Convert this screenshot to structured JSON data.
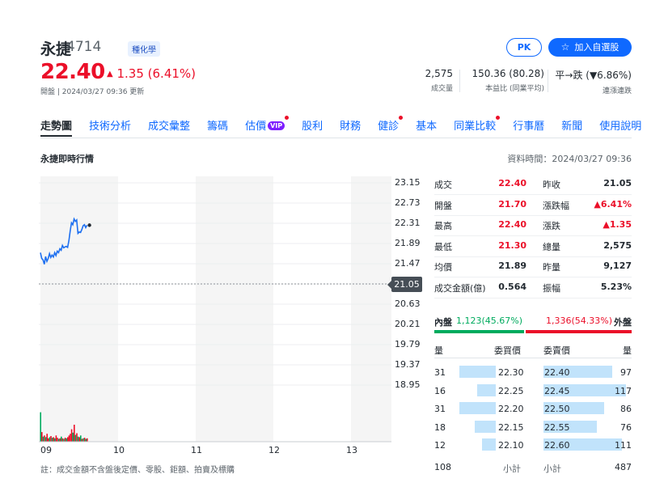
{
  "stock": {
    "name": "永捷",
    "code": "4714",
    "sector": "種化學",
    "price": "22.40",
    "change": "1.35 (6.41%)",
    "change_arrow": "▲",
    "status": "開盤 | 2024/03/27 09:36 更新"
  },
  "header_buttons": {
    "pk": "PK",
    "watchlist": "加入自選股",
    "watchlist_icon": "star-outline-icon"
  },
  "summary_stats": [
    {
      "value": "2,575",
      "label": "成交量"
    },
    {
      "value": "150.36 (80.28)",
      "label": "本益比 (同業平均)"
    },
    {
      "value": "平→跌 (▼6.86%)",
      "label": "連漲連跌"
    }
  ],
  "tabs": [
    {
      "label": "走勢圖",
      "active": true,
      "dot": false,
      "vip": false
    },
    {
      "label": "技術分析",
      "active": false,
      "dot": false,
      "vip": false
    },
    {
      "label": "成交彙整",
      "active": false,
      "dot": false,
      "vip": false
    },
    {
      "label": "籌碼",
      "active": false,
      "dot": false,
      "vip": false
    },
    {
      "label": "估價",
      "active": false,
      "dot": true,
      "vip": true
    },
    {
      "label": "股利",
      "active": false,
      "dot": false,
      "vip": false
    },
    {
      "label": "財務",
      "active": false,
      "dot": false,
      "vip": false
    },
    {
      "label": "健診",
      "active": false,
      "dot": true,
      "vip": false
    },
    {
      "label": "基本",
      "active": false,
      "dot": false,
      "vip": false
    },
    {
      "label": "同業比較",
      "active": false,
      "dot": true,
      "vip": false
    },
    {
      "label": "行事曆",
      "active": false,
      "dot": false,
      "vip": false
    },
    {
      "label": "新聞",
      "active": false,
      "dot": false,
      "vip": false
    },
    {
      "label": "使用說明",
      "active": false,
      "dot": false,
      "vip": false
    }
  ],
  "vip_label": "VIP",
  "section": {
    "title": "永捷即時行情",
    "data_time": "資料時間：2024/03/27 09:36"
  },
  "quote_rows": [
    {
      "l1": "成交",
      "v1": "22.40",
      "c1": "red",
      "l2": "昨收",
      "v2": "21.05",
      "c2": "black"
    },
    {
      "l1": "開盤",
      "v1": "21.70",
      "c1": "red",
      "l2": "漲跌幅",
      "v2": "▲6.41%",
      "c2": "red"
    },
    {
      "l1": "最高",
      "v1": "22.40",
      "c1": "red",
      "l2": "漲跌",
      "v2": "▲1.35",
      "c2": "red"
    },
    {
      "l1": "最低",
      "v1": "21.30",
      "c1": "red",
      "l2": "總量",
      "v2": "2,575",
      "c2": "black"
    },
    {
      "l1": "均價",
      "v1": "21.89",
      "c1": "black",
      "l2": "昨量",
      "v2": "9,127",
      "c2": "black"
    },
    {
      "l1": "成交金額(億)",
      "v1": "0.564",
      "c1": "black",
      "l2": "振幅",
      "v2": "5.23%",
      "c2": "black"
    }
  ],
  "inner_outer": {
    "inner_label": "內盤",
    "inner_value": "1,123(45.67%)",
    "inner_pct": 45.67,
    "outer_label": "外盤",
    "outer_value": "1,336(54.33%)",
    "outer_pct": 54.33
  },
  "order_book": {
    "headers": {
      "bid_qty": "量",
      "bid_price": "委買價",
      "ask_price": "委賣價",
      "ask_qty": "量"
    },
    "rows": [
      {
        "bid_qty": "31",
        "bid_price": "22.30",
        "ask_price": "22.40",
        "ask_qty": "97"
      },
      {
        "bid_qty": "16",
        "bid_price": "22.25",
        "ask_price": "22.45",
        "ask_qty": "117"
      },
      {
        "bid_qty": "31",
        "bid_price": "22.20",
        "ask_price": "22.50",
        "ask_qty": "86"
      },
      {
        "bid_qty": "18",
        "bid_price": "22.15",
        "ask_price": "22.55",
        "ask_qty": "76"
      },
      {
        "bid_qty": "12",
        "bid_price": "22.10",
        "ask_price": "22.60",
        "ask_qty": "111"
      }
    ],
    "totals": {
      "bid_total": "108",
      "bid_label": "小計",
      "ask_label": "小計",
      "ask_total": "487"
    }
  },
  "chart_data": {
    "type": "line",
    "y_ticks": [
      "23.15",
      "22.73",
      "22.31",
      "21.89",
      "21.47",
      "21.05",
      "20.63",
      "20.21",
      "19.79",
      "19.37",
      "18.95"
    ],
    "ylim": [
      18.95,
      23.15
    ],
    "reference_price": "21.05",
    "x_ticks": [
      "09",
      "10",
      "11",
      "12",
      "13"
    ],
    "session_minutes": [
      0,
      270
    ],
    "price_series": {
      "minutes": [
        0,
        1,
        2,
        3,
        4,
        5,
        6,
        7,
        8,
        9,
        10,
        11,
        12,
        13,
        14,
        15,
        16,
        17,
        18,
        19,
        20,
        21,
        22,
        23,
        24,
        25,
        26,
        27,
        28,
        29,
        30,
        31,
        32,
        33,
        34,
        35,
        36
      ],
      "prices": [
        21.7,
        21.58,
        21.55,
        21.46,
        21.62,
        21.52,
        21.58,
        21.68,
        21.6,
        21.65,
        21.61,
        21.7,
        21.64,
        21.73,
        21.7,
        21.78,
        21.75,
        21.85,
        21.8,
        21.82,
        21.83,
        21.81,
        21.95,
        22.15,
        22.32,
        22.28,
        22.4,
        22.35,
        22.38,
        22.1,
        22.13,
        22.12,
        22.18,
        22.26,
        22.28,
        22.22,
        22.27
      ]
    },
    "volume_series": {
      "minutes": [
        0,
        1,
        2,
        3,
        4,
        5,
        6,
        7,
        8,
        9,
        10,
        11,
        12,
        13,
        14,
        15,
        16,
        17,
        18,
        19,
        20,
        21,
        22,
        23,
        24,
        25,
        26,
        27,
        28,
        29,
        30,
        31,
        32,
        33,
        34,
        35,
        36
      ],
      "volumes": [
        260,
        85,
        45,
        55,
        40,
        70,
        30,
        40,
        50,
        35,
        40,
        30,
        55,
        35,
        25,
        30,
        45,
        30,
        25,
        35,
        30,
        40,
        55,
        70,
        110,
        80,
        150,
        60,
        75,
        45,
        40,
        55,
        25,
        30,
        35,
        25,
        30
      ],
      "colors": [
        "g",
        "r",
        "g",
        "r",
        "g",
        "r",
        "r",
        "g",
        "r",
        "g",
        "r",
        "g",
        "r",
        "r",
        "g",
        "r",
        "g",
        "r",
        "g",
        "r",
        "g",
        "r",
        "r",
        "r",
        "r",
        "g",
        "r",
        "g",
        "r",
        "g",
        "r",
        "g",
        "r",
        "g",
        "r",
        "g",
        "r"
      ],
      "max": 500
    },
    "colors": {
      "line": "#1d6ff0",
      "up": "#eb0f29",
      "down": "#00ab5e",
      "band": "#f5f5f5"
    }
  },
  "footnote": "註：成交金額不含盤後定價、零股、鉅額、拍賣及標購"
}
